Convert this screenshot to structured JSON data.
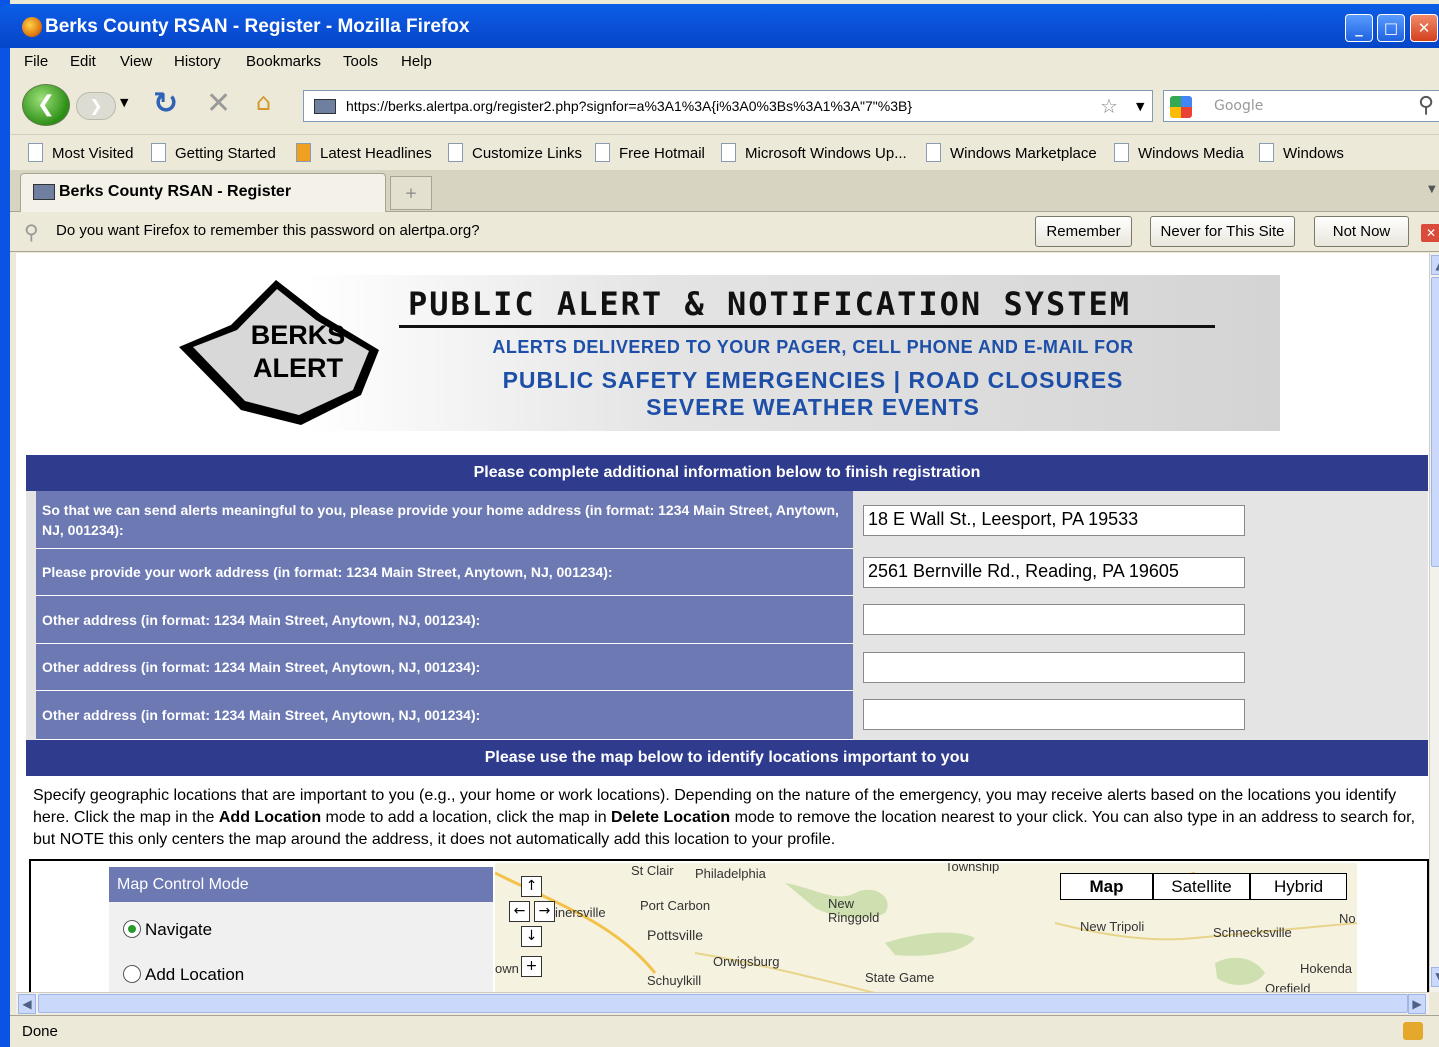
{
  "window": {
    "title": "Berks County RSAN - Register - Mozilla Firefox",
    "min_glyph": "_",
    "max_glyph": "□",
    "close_glyph": "✕"
  },
  "menu": [
    "File",
    "Edit",
    "View",
    "History",
    "Bookmarks",
    "Tools",
    "Help"
  ],
  "nav": {
    "url": "https://berks.alertpa.org/register2.php?signfor=a%3A1%3A{i%3A0%3Bs%3A1%3A\"7\"%3B}",
    "search_placeholder": "Google"
  },
  "bookmarks": [
    "Most Visited",
    "Getting Started",
    "Latest Headlines",
    "Customize Links",
    "Free Hotmail",
    "Microsoft Windows Up...",
    "Windows Marketplace",
    "Windows Media",
    "Windows"
  ],
  "tab": {
    "title": "Berks County RSAN - Register"
  },
  "notification": {
    "text": "Do you want Firefox to remember this password on alertpa.org?",
    "remember": "Remember",
    "never": "Never for This Site",
    "not_now": "Not Now"
  },
  "banner": {
    "logo_line1": "BERKS",
    "logo_line2": "ALERT",
    "title": "PUBLIC ALERT & NOTIFICATION SYSTEM",
    "subtitle": "ALERTS DELIVERED TO YOUR PAGER, CELL PHONE AND E-MAIL FOR",
    "line2": "PUBLIC SAFETY EMERGENCIES | ROAD CLOSURES",
    "line3": "SEVERE WEATHER EVENTS"
  },
  "form": {
    "header": "Please complete additional information below to finish registration",
    "rows": [
      {
        "label": "So that we can send alerts meaningful to you, please provide your home address (in format: 1234 Main Street, Anytown, NJ, 001234):",
        "value": "18 E Wall St., Leesport, PA 19533"
      },
      {
        "label": "Please provide your work address (in format: 1234 Main Street, Anytown, NJ, 001234):",
        "value": "2561 Bernville Rd., Reading, PA 19605"
      },
      {
        "label": "Other address (in format: 1234 Main Street, Anytown, NJ, 001234):",
        "value": ""
      },
      {
        "label": "Other address (in format: 1234 Main Street, Anytown, NJ, 001234):",
        "value": ""
      },
      {
        "label": "Other address (in format: 1234 Main Street, Anytown, NJ, 001234):",
        "value": ""
      }
    ]
  },
  "map_section": {
    "header": "Please use the map below to identify locations important to you",
    "desc_1": "Specify geographic locations that are important to you (e.g., your home or work locations). Depending on the nature of the emergency, you may receive alerts based on the locations you identify here. Click the map in the ",
    "desc_add": "Add Location",
    "desc_2": " mode to add a location, click the map in ",
    "desc_delete": "Delete Location",
    "desc_3": " mode to remove the location nearest to your click. You can also type in an address to search for, but NOTE this only centers the map around the address, it does not automatically add this location to your profile.",
    "control_header": "Map Control Mode",
    "mode_navigate": "Navigate",
    "mode_add": "Add Location",
    "map_types": [
      "Map",
      "Satellite",
      "Hybrid"
    ],
    "places": [
      "St Clair",
      "Philadelphia",
      "Township",
      "inersville",
      "Port Carbon",
      "New Ringgold",
      "Pottsville",
      "New Tripoli",
      "Schnecksville",
      "No",
      "Orwigsburg",
      "Schuylkill",
      "State Game",
      "Hokenda",
      "own",
      "Orefield"
    ]
  },
  "status": {
    "text": "Done"
  }
}
